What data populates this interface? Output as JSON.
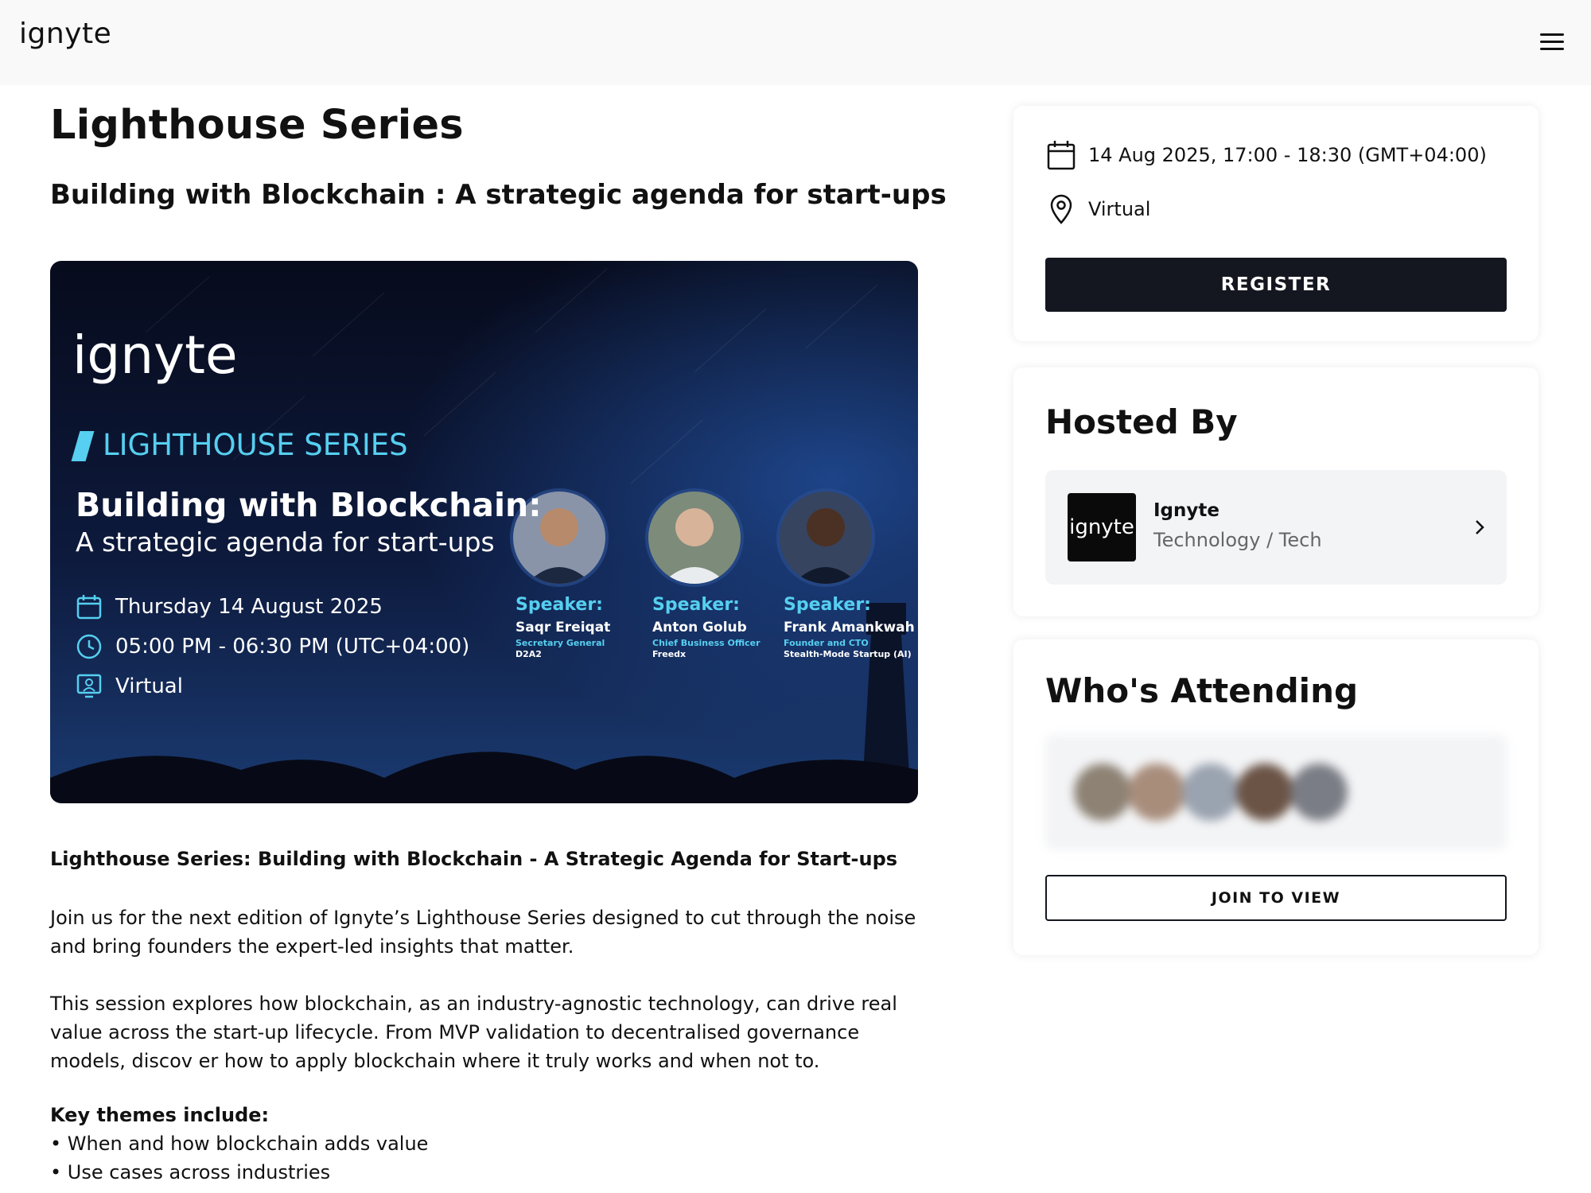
{
  "header": {
    "brand": "ignyte",
    "menu_icon": "hamburger-menu-icon"
  },
  "event": {
    "title": "Lighthouse Series",
    "subtitle": "Building with Blockchain : A strategic agenda for start-ups"
  },
  "banner": {
    "logo": "ignyte",
    "series": "LIGHTHOUSE SERIES",
    "headline": "Building with Blockchain:",
    "headline_sub": "A strategic agenda for start-ups",
    "date": "Thursday 14 August 2025",
    "time": "05:00 PM - 06:30 PM (UTC+04:00)",
    "location": "Virtual",
    "accent_color": "#56cff0",
    "speakers": [
      {
        "label": "Speaker:",
        "name": "Saqr Ereiqat",
        "role": "Secretary General",
        "company": "D2A2"
      },
      {
        "label": "Speaker:",
        "name": "Anton Golub",
        "role": "Chief Business Officer",
        "company": "Freedx"
      },
      {
        "label": "Speaker:",
        "name": "Frank Amankwah",
        "role": "Founder and CTO",
        "company": "Stealth-Mode Startup (AI)"
      }
    ]
  },
  "description": {
    "heading": "Lighthouse Series: Building with Blockchain - A Strategic Agenda for Start-ups",
    "para1": "Join us for the next edition of Ignyte’s Lighthouse Series designed to cut through the noise and bring founders the expert-led insights that matter.",
    "para2": "This session explores how blockchain, as an industry-agnostic technology, can drive real value across the start-up lifecycle. From MVP validation to decentralised governance models, discov er how to apply blockchain where it truly works and when not to.",
    "themes_heading": "Key themes include:",
    "themes": [
      "• When and how blockchain adds value",
      "• Use cases across industries"
    ]
  },
  "event_card": {
    "datetime": "14 Aug 2025, 17:00 - 18:30 (GMT+04:00)",
    "location": "Virtual",
    "register_label": "REGISTER"
  },
  "host_card": {
    "heading": "Hosted By",
    "logo_text": "ignyte",
    "name": "Ignyte",
    "category": "Technology / Tech"
  },
  "attending_card": {
    "heading": "Who's Attending",
    "join_label": "JOIN TO VIEW"
  },
  "colors": {
    "button_dark": "#14171f",
    "header_bg": "#f9f9f9",
    "banner_bg": "#0b1430"
  }
}
